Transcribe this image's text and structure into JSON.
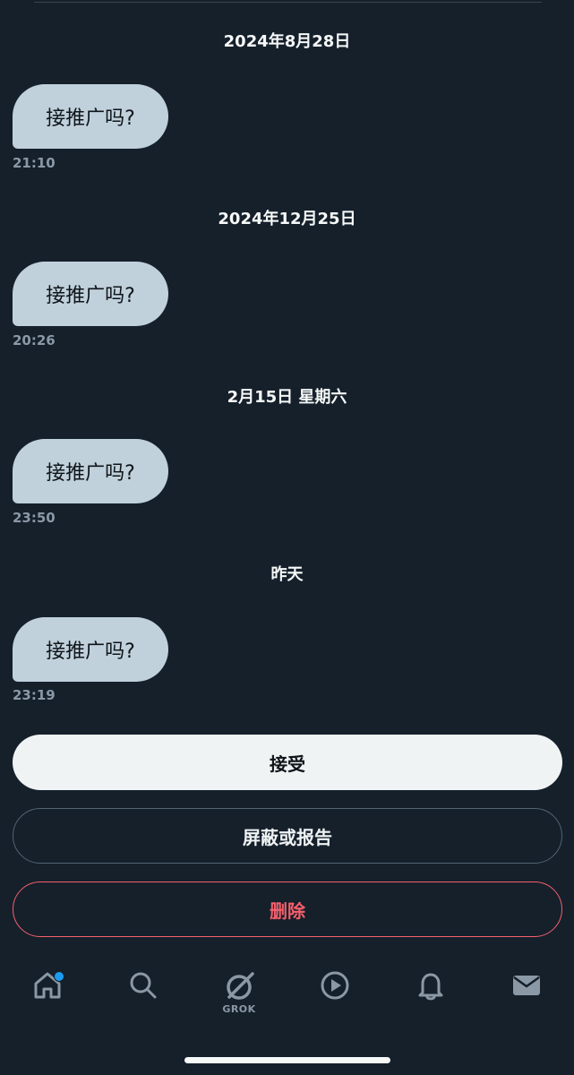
{
  "messages": [
    {
      "date": "2024年8月28日",
      "text": "接推广吗?",
      "time": "21:10"
    },
    {
      "date": "2024年12月25日",
      "text": "接推广吗?",
      "time": "20:26"
    },
    {
      "date": "2月15日 星期六",
      "text": "接推广吗?",
      "time": "23:50"
    },
    {
      "date": "昨天",
      "text": "接推广吗?",
      "time": "23:19"
    }
  ],
  "actions": {
    "accept_label": "接受",
    "block_label": "屏蔽或报告",
    "delete_label": "删除"
  },
  "tabbar": {
    "grok_label": "GROK",
    "icons": [
      "home-icon",
      "search-icon",
      "grok-icon",
      "play-icon",
      "bell-icon",
      "mail-icon"
    ],
    "home_has_badge": true
  },
  "colors": {
    "background": "#15202b",
    "bubble": "#c0d1dc",
    "accent_blue": "#1d9bf0",
    "danger": "#f4606c"
  }
}
